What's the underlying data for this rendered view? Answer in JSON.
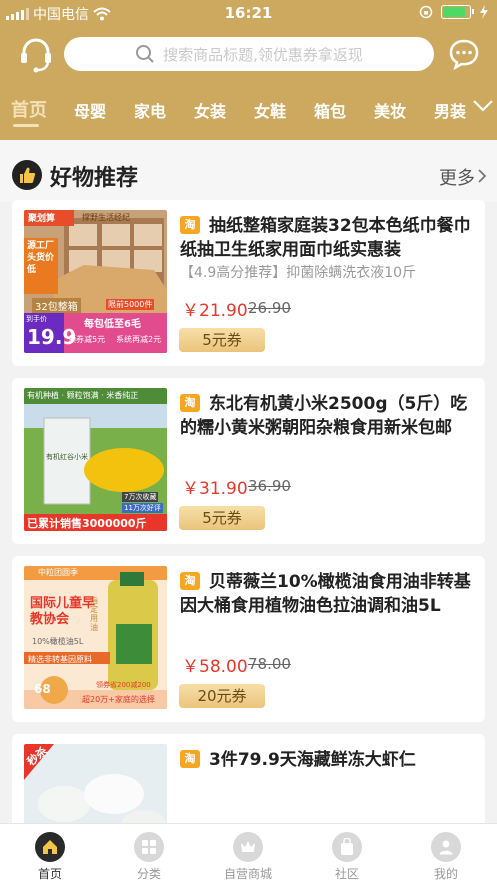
{
  "status": {
    "carrier": "中国电信",
    "time": "16:21"
  },
  "search": {
    "placeholder": "搜索商品标题,领优惠券拿返现"
  },
  "tabs": [
    "首页",
    "母婴",
    "家电",
    "女装",
    "女鞋",
    "箱包",
    "美妆",
    "男装"
  ],
  "section": {
    "title": "好物推荐",
    "more": "更多"
  },
  "products": [
    {
      "name": "抽纸整箱家庭装32包本色纸巾餐巾纸抽卫生纸家用面巾纸实惠装",
      "subtitle": "【4.9高分推荐】抑菌除螨洗衣液10斤",
      "price": "￥21.90",
      "orig": "26.90",
      "coupon": "5元券",
      "img": {
        "top_tag": "聚划算",
        "brand": "撑野生活经纪",
        "side_text": "源工厂头货价低",
        "count_label": "32包整箱",
        "limit": "限前5000件",
        "cta": "每包低至6毛",
        "price_prefix": "到手价",
        "price": "19.9",
        "promo1": "领券减5元",
        "promo2": "系统再减2元"
      }
    },
    {
      "name": "东北有机黄小米2500g（5斤）吃的糯小黄米粥朝阳杂粮食用新米包邮",
      "subtitle": "",
      "price": "￥31.90",
      "orig": "36.90",
      "coupon": "5元券",
      "img": {
        "top_banner": "有机种植 · 颗粒饱满 · 米香纯正",
        "bag_label": "有机红谷小米",
        "stat1": "7万次收藏",
        "stat2": "11万次好评",
        "bottom_banner": "已累计销售3000000斤"
      }
    },
    {
      "name": "贝蒂薇兰10%橄榄油食用油非转基因大桶食用植物油色拉油调和油5L",
      "subtitle": "",
      "price": "￥58.00",
      "orig": "78.00",
      "coupon": "20元券",
      "img": {
        "top_tag": "中粒团圆季",
        "title": "国际儿童早教协会",
        "side": "指定用油",
        "bottle_note": "10%橄榄油5L",
        "ribbon": "精选非转基因原料",
        "price": "68",
        "promo": "领券省200减200",
        "footer": "超20万+家庭的选择"
      }
    },
    {
      "name": "3件79.9天海藏鲜冻大虾仁",
      "subtitle": "",
      "price": "",
      "orig": "",
      "coupon": "",
      "img": {
        "badge": "秒杀"
      }
    }
  ],
  "tabbar": [
    {
      "label": "首页",
      "icon": "home-icon"
    },
    {
      "label": "分类",
      "icon": "category-icon"
    },
    {
      "label": "自营商城",
      "icon": "crown-icon"
    },
    {
      "label": "社区",
      "icon": "community-icon"
    },
    {
      "label": "我的",
      "icon": "user-icon"
    }
  ],
  "colors": {
    "brand": "#cda85f",
    "price": "#e8372a",
    "accent_tab": "#f3e1b7"
  }
}
